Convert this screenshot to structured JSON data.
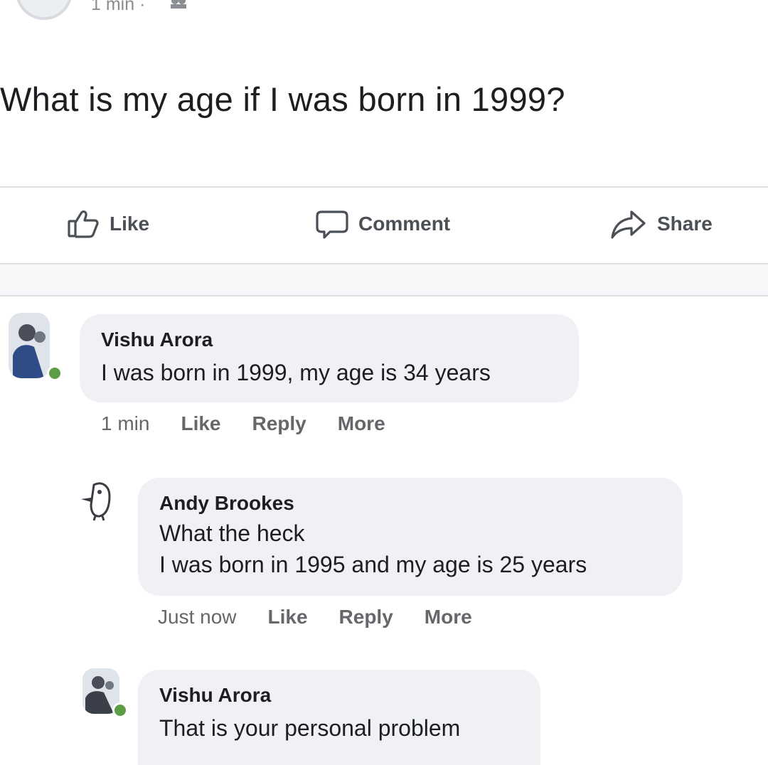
{
  "post": {
    "time": "1 min · ",
    "text": "What is my age if I was born in 1999?"
  },
  "actions": {
    "like": "Like",
    "comment": "Comment",
    "share": "Share"
  },
  "comments": [
    {
      "author": "Vishu Arora",
      "lines": [
        "I was born in 1999, my age is 34 years"
      ],
      "time": "1 min",
      "like": "Like",
      "reply": "Reply",
      "more": "More"
    },
    {
      "author": "Andy Brookes",
      "lines": [
        "What the heck",
        "I was born in 1995 and my age is 25 years"
      ],
      "time": "Just now",
      "like": "Like",
      "reply": "Reply",
      "more": "More"
    },
    {
      "author": "Vishu Arora",
      "lines": [
        "That is your personal problem"
      ]
    }
  ],
  "colors": {
    "bubble": "#f0f1f4",
    "online": "#5b9e45",
    "meta_text": "#65676b"
  }
}
